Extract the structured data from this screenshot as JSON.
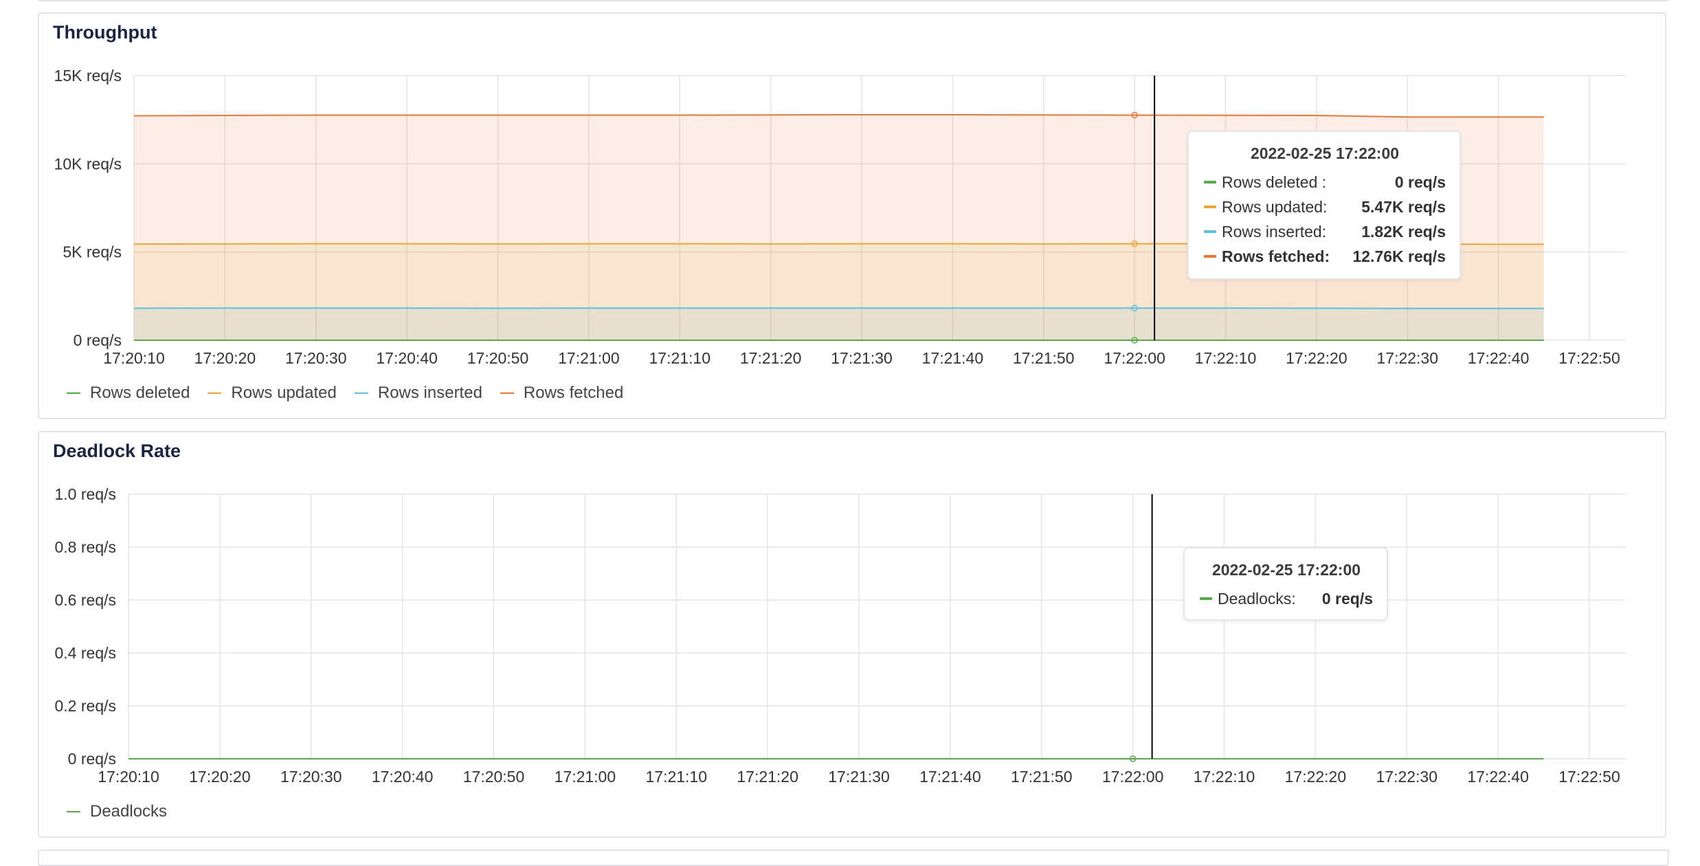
{
  "panels": {
    "throughput": {
      "title": "Throughput",
      "tooltip": {
        "time": "2022-02-25 17:22:00",
        "rows": [
          {
            "label": "Rows deleted :",
            "value": "0 req/s",
            "color": "#5aa64b"
          },
          {
            "label": "Rows updated:",
            "value": "5.47K req/s",
            "color": "#e8a838"
          },
          {
            "label": "Rows inserted:",
            "value": "1.82K req/s",
            "color": "#5bc0d8"
          },
          {
            "label": "Rows fetched:",
            "value": "12.76K req/s",
            "color": "#e8773c"
          }
        ]
      },
      "legend": [
        {
          "label": "Rows deleted",
          "color": "#5aa64b"
        },
        {
          "label": "Rows updated",
          "color": "#e8a838"
        },
        {
          "label": "Rows inserted",
          "color": "#5bc0d8"
        },
        {
          "label": "Rows fetched",
          "color": "#e8773c"
        }
      ]
    },
    "deadlock": {
      "title": "Deadlock Rate",
      "tooltip": {
        "time": "2022-02-25 17:22:00",
        "rows": [
          {
            "label": "Deadlocks:",
            "value": "0 req/s",
            "color": "#5aa64b"
          }
        ]
      },
      "legend": [
        {
          "label": "Deadlocks",
          "color": "#5aa64b"
        }
      ]
    }
  },
  "chart_data": [
    {
      "type": "area",
      "title": "Throughput",
      "x": [
        "17:20:10",
        "17:20:20",
        "17:20:30",
        "17:20:40",
        "17:20:50",
        "17:21:00",
        "17:21:10",
        "17:21:20",
        "17:21:30",
        "17:21:40",
        "17:21:50",
        "17:22:00",
        "17:22:10",
        "17:22:20",
        "17:22:30",
        "17:22:40",
        "17:22:45"
      ],
      "x_ticks": [
        "17:20:10",
        "17:20:20",
        "17:20:30",
        "17:20:40",
        "17:20:50",
        "17:21:00",
        "17:21:10",
        "17:21:20",
        "17:21:30",
        "17:21:40",
        "17:21:50",
        "17:22:00",
        "17:22:10",
        "17:22:20",
        "17:22:30",
        "17:22:40",
        "17:22:50"
      ],
      "y_ticks": [
        "0 req/s",
        "5K req/s",
        "10K req/s",
        "15K req/s"
      ],
      "y_unit": "req/s",
      "ylim": [
        0,
        15000
      ],
      "grid": true,
      "legend_position": "bottom-left",
      "hover_x": "17:22:00",
      "series": [
        {
          "name": "Rows deleted",
          "color": "#5aa64b",
          "fill": false,
          "values": [
            0,
            0,
            0,
            0,
            0,
            0,
            0,
            0,
            0,
            0,
            0,
            0,
            0,
            0,
            0,
            0,
            0
          ]
        },
        {
          "name": "Rows updated",
          "color": "#e8a838",
          "fill": true,
          "values": [
            5450,
            5460,
            5470,
            5470,
            5460,
            5470,
            5470,
            5460,
            5470,
            5470,
            5460,
            5470,
            5470,
            5460,
            5450,
            5440,
            5440
          ]
        },
        {
          "name": "Rows inserted",
          "color": "#5bc0d8",
          "fill": true,
          "values": [
            1810,
            1820,
            1820,
            1820,
            1810,
            1820,
            1820,
            1820,
            1820,
            1820,
            1820,
            1820,
            1820,
            1810,
            1800,
            1800,
            1800
          ]
        },
        {
          "name": "Rows fetched",
          "color": "#e8773c",
          "fill": true,
          "values": [
            12720,
            12740,
            12760,
            12760,
            12760,
            12760,
            12760,
            12770,
            12780,
            12780,
            12770,
            12760,
            12750,
            12740,
            12650,
            12650,
            12650
          ]
        }
      ]
    },
    {
      "type": "line",
      "title": "Deadlock Rate",
      "x": [
        "17:20:10",
        "17:20:20",
        "17:20:30",
        "17:20:40",
        "17:20:50",
        "17:21:00",
        "17:21:10",
        "17:21:20",
        "17:21:30",
        "17:21:40",
        "17:21:50",
        "17:22:00",
        "17:22:10",
        "17:22:20",
        "17:22:30",
        "17:22:40",
        "17:22:45"
      ],
      "x_ticks": [
        "17:20:10",
        "17:20:20",
        "17:20:30",
        "17:20:40",
        "17:20:50",
        "17:21:00",
        "17:21:10",
        "17:21:20",
        "17:21:30",
        "17:21:40",
        "17:21:50",
        "17:22:00",
        "17:22:10",
        "17:22:20",
        "17:22:30",
        "17:22:40",
        "17:22:50"
      ],
      "y_ticks": [
        "0 req/s",
        "0.2 req/s",
        "0.4 req/s",
        "0.6 req/s",
        "0.8 req/s",
        "1.0 req/s"
      ],
      "y_unit": "req/s",
      "ylim": [
        0,
        1.0
      ],
      "grid": true,
      "legend_position": "bottom-left",
      "hover_x": "17:22:00",
      "series": [
        {
          "name": "Deadlocks",
          "color": "#5aa64b",
          "fill": false,
          "values": [
            0,
            0,
            0,
            0,
            0,
            0,
            0,
            0,
            0,
            0,
            0,
            0,
            0,
            0,
            0,
            0,
            0
          ]
        }
      ]
    }
  ]
}
